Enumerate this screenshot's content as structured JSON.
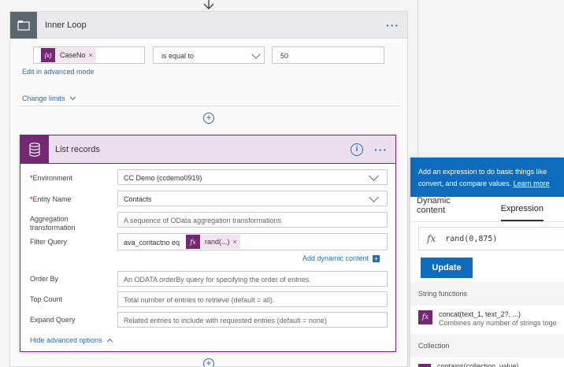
{
  "loop": {
    "title": "Inner Loop",
    "more_label": "···",
    "condition": {
      "token_label": "CaseNo",
      "token_icon": "{x}",
      "token_remove": "×",
      "operator": "is equal to",
      "value": "50"
    },
    "edit_advanced_label": "Edit in advanced mode",
    "change_limits_label": "Change limits",
    "add_step_label": "+"
  },
  "card": {
    "title": "List records",
    "info_label": "i",
    "more_label": "···",
    "fields": {
      "environment": {
        "label": "Environment",
        "required": "*",
        "value": "CC Demo (ccdemo0919)"
      },
      "entity_name": {
        "label": "Entity Name",
        "required": "*",
        "value": "Contacts"
      },
      "aggregation": {
        "label_line1": "Aggregation",
        "label_line2": "transformation",
        "placeholder": "A sequence of OData aggregation transformations"
      },
      "filter_query": {
        "label": "Filter Query",
        "prefix": "ava_contactno eq",
        "token_label": "rand(...)",
        "token_icon": "fx",
        "token_remove": "×"
      },
      "order_by": {
        "label": "Order By",
        "placeholder": "An ODATA orderBy query for specifying the order of entries."
      },
      "top_count": {
        "label": "Top Count",
        "placeholder": "Total number of entries to retrieve (default = all)."
      },
      "expand_query": {
        "label": "Expand Query",
        "placeholder": "Related entries to include with requested entries (default = none)"
      }
    },
    "add_dynamic_label": "Add dynamic content",
    "hide_advanced_label": "Hide advanced options"
  },
  "panel": {
    "banner_line1": "Add an expression to do basic things like",
    "banner_line2": "convert, and compare values.",
    "learn_more": "Learn more",
    "tabs": [
      "Dynamic content",
      "Expression"
    ],
    "active_tab": "Expression",
    "expression": "rand(0,875)",
    "update_label": "Update",
    "section_string": "String functions",
    "fn_concat_name": "concat(text_1, text_2?, ...)",
    "fn_concat_desc": "Combines any number of strings toge",
    "section_collection": "Collection",
    "fn_partial": "contains(collection, value)"
  },
  "colors": {
    "accent": "#742774",
    "link": "#2d6ab5",
    "primary_button": "#0f6cbd"
  }
}
